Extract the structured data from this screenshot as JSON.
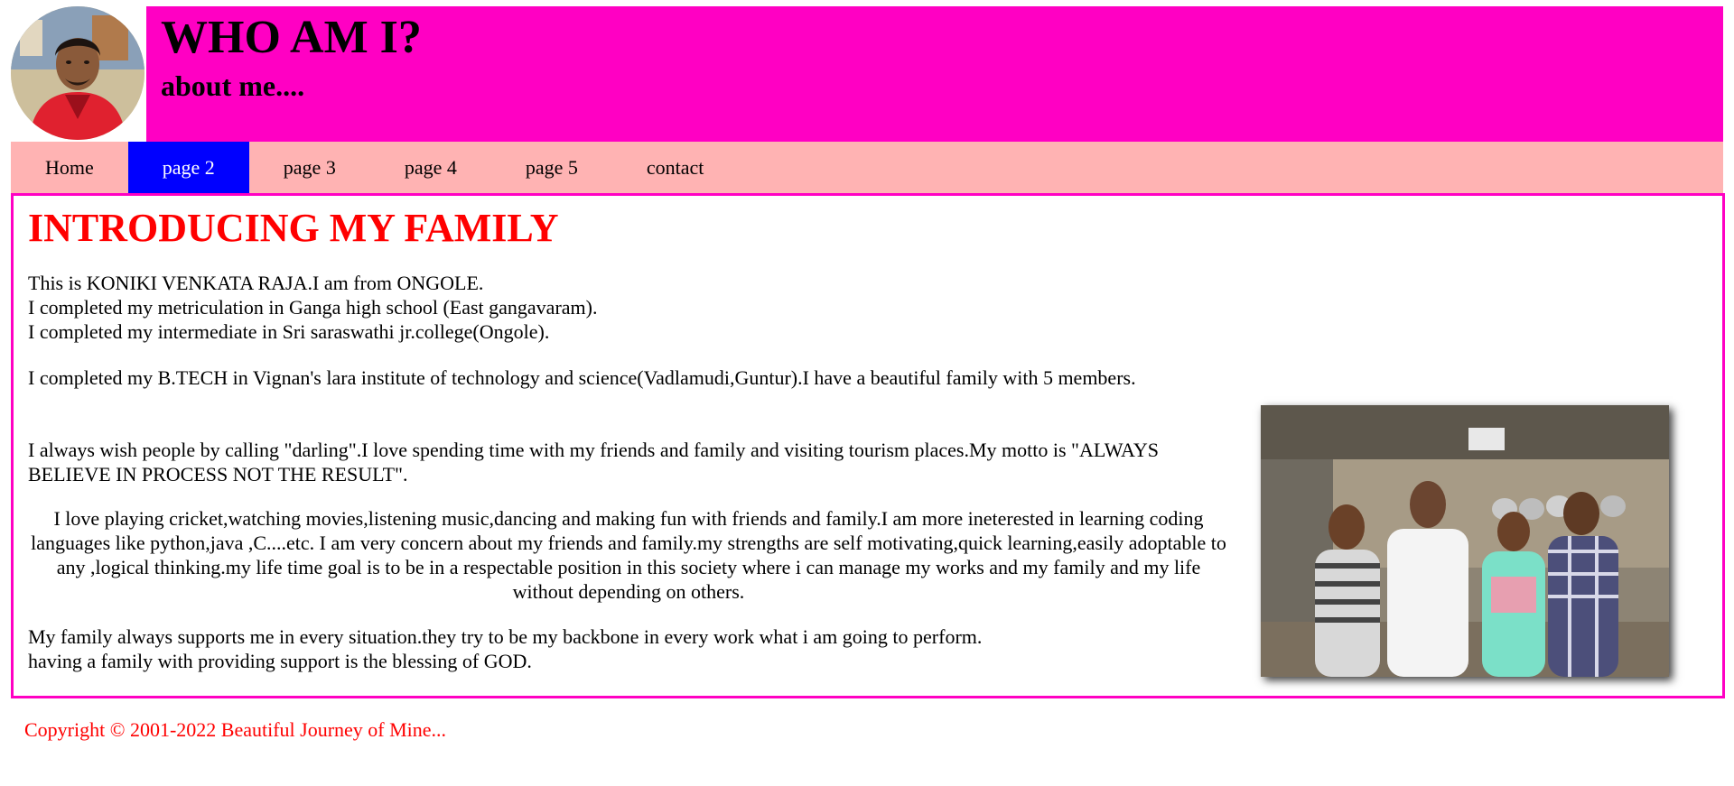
{
  "header": {
    "title": "WHO AM I?",
    "subtitle": "about me...."
  },
  "nav": {
    "items": [
      {
        "label": "Home",
        "active": false
      },
      {
        "label": "page 2",
        "active": true
      },
      {
        "label": "page 3",
        "active": false
      },
      {
        "label": "page 4",
        "active": false
      },
      {
        "label": "page 5",
        "active": false
      },
      {
        "label": "contact",
        "active": false
      }
    ]
  },
  "main": {
    "heading": "INTRODUCING MY FAMILY",
    "paragraphs": [
      [
        "This is KONIKI VENKATA RAJA.I am from ONGOLE.",
        "I completed my metriculation in Ganga high school (East gangavaram).",
        "I completed my intermediate in Sri saraswathi jr.college(Ongole)."
      ],
      [
        "I completed my B.TECH in Vignan's lara institute of technology and science(Vadlamudi,Guntur).I have a beautiful family with 5 members."
      ],
      [
        "I always wish people by calling \"darling\".I love spending time with my friends and family and visiting tourism places.My motto is \"ALWAYS BELIEVE IN PROCESS NOT THE RESULT\"."
      ],
      [
        "I love playing cricket,watching movies,listening music,dancing and making fun with friends and family.I am more ineterested in learning coding languages like python,java ,C....etc. I am very concern about my friends and family.my strengths are self motivating,quick learning,easily adoptable to any ,logical thinking.my life time goal is to be in a respectable position in this society where i can manage my works and my family and my life without depending on others."
      ],
      [
        "My family always supports me in every situation.they try to be my backbone in every work what i am going to perform.",
        "having a family with providing support is the blessing of GOD."
      ]
    ]
  },
  "footer": {
    "copyright": "Copyright © 2001-2022 Beautiful Journey of Mine..."
  },
  "colors": {
    "header_bg": "#ff00c3",
    "nav_bg": "#ffb3b3",
    "nav_active_bg": "#0000ff",
    "heading_color": "#ff0000",
    "border_color": "#ff00c3",
    "footer_color": "#ff0000"
  }
}
